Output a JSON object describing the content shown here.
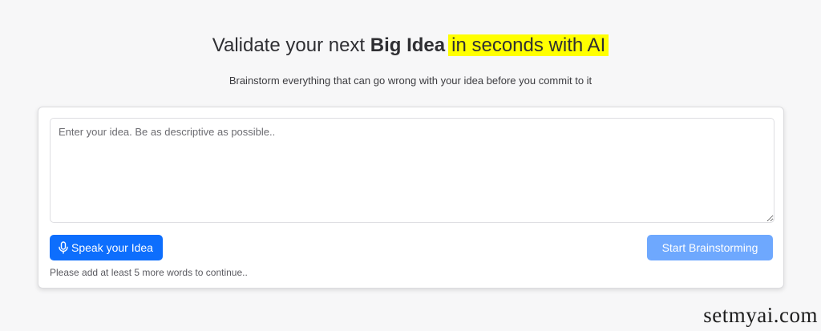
{
  "hero": {
    "title_prefix": "Validate your next ",
    "title_bold": "Big Idea",
    "title_highlight": "in seconds with AI",
    "highlight_color": "#ffff00"
  },
  "subtitle": "Brainstorm everything that can go wrong with your idea before you commit to it",
  "form": {
    "idea_placeholder": "Enter your idea. Be as descriptive as possible..",
    "idea_value": "",
    "speak_label": "Speak your Idea",
    "speak_icon": "microphone-icon",
    "start_label": "Start Brainstorming",
    "hint": "Please add at least 5 more words to continue..",
    "primary_color": "#0d6efd",
    "disabled_color": "#6ea8fe"
  },
  "watermark": "setmyai.com"
}
